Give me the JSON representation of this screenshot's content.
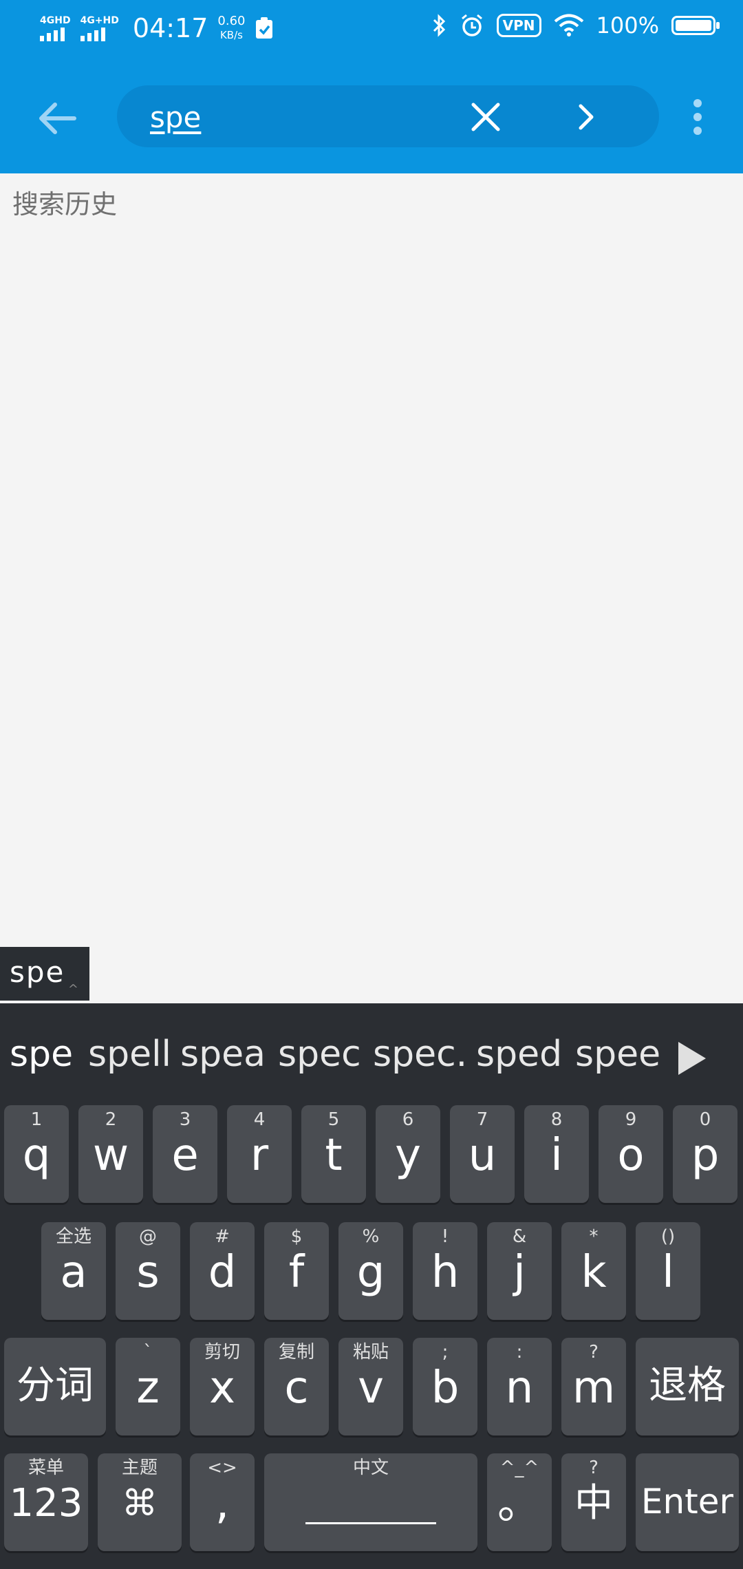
{
  "status_bar": {
    "signal1_label": "4GHD",
    "signal2_label": "4G+HD",
    "time": "04:17",
    "speed_value": "0.60",
    "speed_unit": "KB/s",
    "vpn_label": "VPN",
    "battery_percent": "100%",
    "battery_level": 1.0
  },
  "toolbar": {
    "search_value": "spe",
    "back_icon": "arrow-left-icon",
    "clear_icon": "close-icon",
    "go_icon": "chevron-right-icon",
    "more_icon": "more-vert-icon"
  },
  "history": {
    "title": "搜索历史"
  },
  "ime": {
    "composing_text": "spe",
    "candidates": [
      "spe",
      "spell",
      "spea",
      "spec",
      "spec.",
      "sped",
      "spee"
    ],
    "row1": [
      {
        "sub": "1",
        "main": "q"
      },
      {
        "sub": "2",
        "main": "w"
      },
      {
        "sub": "3",
        "main": "e"
      },
      {
        "sub": "4",
        "main": "r"
      },
      {
        "sub": "5",
        "main": "t"
      },
      {
        "sub": "6",
        "main": "y"
      },
      {
        "sub": "7",
        "main": "u"
      },
      {
        "sub": "8",
        "main": "i"
      },
      {
        "sub": "9",
        "main": "o"
      },
      {
        "sub": "0",
        "main": "p"
      }
    ],
    "row2": [
      {
        "sub": "全选",
        "main": "a"
      },
      {
        "sub": "@",
        "main": "s"
      },
      {
        "sub": "#",
        "main": "d"
      },
      {
        "sub": "$",
        "main": "f"
      },
      {
        "sub": "%",
        "main": "g"
      },
      {
        "sub": "!",
        "main": "h"
      },
      {
        "sub": "&",
        "main": "j"
      },
      {
        "sub": "*",
        "main": "k"
      },
      {
        "sub": "()",
        "main": "l"
      }
    ],
    "row3": {
      "left": "分词",
      "letters": [
        {
          "sub": "`",
          "main": "z"
        },
        {
          "sub": "剪切",
          "main": "x"
        },
        {
          "sub": "复制",
          "main": "c"
        },
        {
          "sub": "粘贴",
          "main": "v"
        },
        {
          "sub": ";",
          "main": "b"
        },
        {
          "sub": ":",
          "main": "n"
        },
        {
          "sub": "?",
          "main": "m"
        }
      ],
      "right": "退格"
    },
    "row4": {
      "num": {
        "sub": "菜单",
        "main": "123"
      },
      "theme": {
        "sub": "主题",
        "main": "⌘"
      },
      "comma": {
        "sub": "<>",
        "main": ","
      },
      "space": {
        "sub": "中文"
      },
      "period": {
        "sub": "^_^",
        "main": "。"
      },
      "lang": {
        "sub": "?",
        "main": "中"
      },
      "enter": {
        "main": "Enter"
      }
    }
  }
}
